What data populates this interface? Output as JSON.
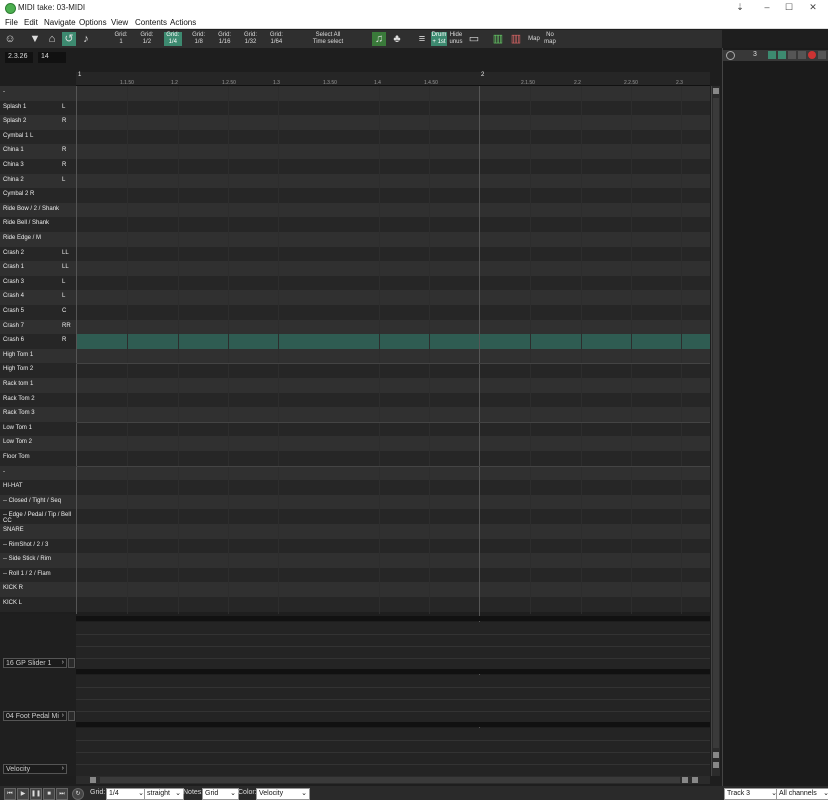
{
  "window": {
    "title": "MIDI take: 03-MIDI"
  },
  "menu": [
    "File",
    "Edit",
    "Navigate",
    "Options",
    "View",
    "Contents",
    "Actions"
  ],
  "toolbar": {
    "grid_buttons": [
      {
        "l1": "Grid:",
        "l2": "1",
        "active": false
      },
      {
        "l1": "Grid:",
        "l2": "1/2",
        "active": false
      },
      {
        "l1": "Grid:",
        "l2": "1/4",
        "active": true
      },
      {
        "l1": "Grid:",
        "l2": "1/8",
        "active": false
      },
      {
        "l1": "Grid:",
        "l2": "1/16",
        "active": false
      },
      {
        "l1": "Grid:",
        "l2": "1/32",
        "active": false
      },
      {
        "l1": "Grid:",
        "l2": "1/64",
        "active": false
      }
    ],
    "select_all_l1": "Select All",
    "select_all_l2": "Time select",
    "drum_l1": "Drum",
    "drum_l2": "+ 1st",
    "hide_l1": "Hide",
    "hide_l2": "unus",
    "map_label": "Map",
    "no_map_l1": "No",
    "no_map_l2": "map"
  },
  "position": {
    "time": "2.3.26",
    "value": "14"
  },
  "ruler": {
    "major": [
      {
        "label": "1"
      },
      {
        "label": "2"
      }
    ],
    "minor": [
      "1.1.50",
      "1.2",
      "1.2.50",
      "1.3",
      "1.3.50",
      "1.4",
      "1.4.50",
      "2.1.50",
      "2.2",
      "2.2.50",
      "2.3"
    ]
  },
  "keys": [
    {
      "name": "-",
      "side": ""
    },
    {
      "name": "Splash 1",
      "side": "L"
    },
    {
      "name": "Splash 2",
      "side": "R"
    },
    {
      "name": "Cymbal 1 L",
      "side": ""
    },
    {
      "name": "China 1",
      "side": "R"
    },
    {
      "name": "China 3",
      "side": "R"
    },
    {
      "name": "China 2",
      "side": "L"
    },
    {
      "name": "Cymbal 2 R",
      "side": ""
    },
    {
      "name": "Ride Bow / 2 / Shank",
      "side": ""
    },
    {
      "name": "Ride Bell  / Shank",
      "side": ""
    },
    {
      "name": "Ride Edge / M",
      "side": ""
    },
    {
      "name": "Crash 2",
      "side": "LL"
    },
    {
      "name": "Crash 1",
      "side": "LL"
    },
    {
      "name": "Crash 3",
      "side": "L"
    },
    {
      "name": "Crash 4",
      "side": "L"
    },
    {
      "name": "Crash 5",
      "side": "C"
    },
    {
      "name": "Crash 7",
      "side": "RR"
    },
    {
      "name": "Crash 6",
      "side": "R"
    },
    {
      "name": "High Tom 1",
      "side": ""
    },
    {
      "name": "High Tom 2",
      "side": ""
    },
    {
      "name": "Rack tom 1",
      "side": ""
    },
    {
      "name": "Rack Tom 2",
      "side": ""
    },
    {
      "name": "Rack Tom 3",
      "side": ""
    },
    {
      "name": "Low Tom 1",
      "side": ""
    },
    {
      "name": "Low Tom 2",
      "side": ""
    },
    {
      "name": "Floor Tom",
      "side": ""
    },
    {
      "name": "-",
      "side": ""
    },
    {
      "name": "HI-HAT",
      "side": ""
    },
    {
      "name": "-- Closed / Tight / Seq",
      "side": ""
    },
    {
      "name": "-- Edge / Pedal / Tip / Bell CC",
      "side": ""
    },
    {
      "name": "SNARE",
      "side": ""
    },
    {
      "name": "-- RimShot / 2 / 3",
      "side": ""
    },
    {
      "name": "-- Side Stick / Rim",
      "side": ""
    },
    {
      "name": "-- Roll 1 / 2 / Flam",
      "side": ""
    },
    {
      "name": "KICK R",
      "side": ""
    },
    {
      "name": "KICK L",
      "side": ""
    }
  ],
  "selected_row_index": 17,
  "lanes": [
    {
      "label": "16 GP Slider 1"
    },
    {
      "label": "04 Foot Pedal Mi"
    },
    {
      "label": "Velocity"
    }
  ],
  "right_panel": {
    "track_number": "3"
  },
  "bottom": {
    "grid_label": "Grid:",
    "grid_value": "1/4",
    "swing_value": "straight",
    "notes_label": "Notes:",
    "notes_value": "Grid",
    "color_label": "Color:",
    "color_value": "Velocity",
    "track_value": "Track 3",
    "channel_value": "All channels"
  },
  "colors": {
    "accent": "#3d8a70",
    "selected_row": "#2f5c52",
    "row_dark": "#262626",
    "row_light": "#303030"
  }
}
